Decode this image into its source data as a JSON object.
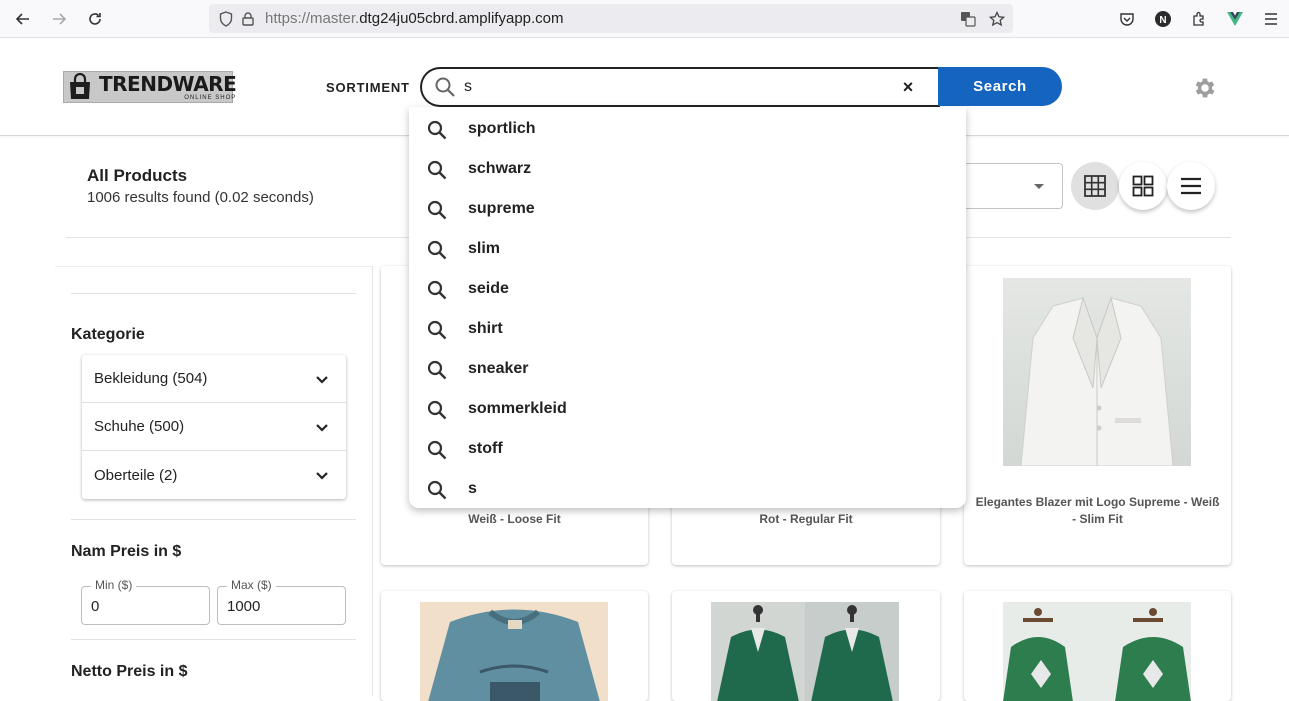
{
  "browser": {
    "url_dim": "https://master.",
    "url_main": "dtg24ju05cbrd.amplifyapp.com"
  },
  "header": {
    "logo_title": "TRENDWARE",
    "logo_subtitle": "ONLINE SHOP",
    "nav_label": "SORTIMENT",
    "search_value": "s",
    "clear_label": "×",
    "search_button": "Search"
  },
  "results": {
    "title": "All Products",
    "count": "1006 results found (0.02 seconds)"
  },
  "sidebar": {
    "category_heading": "Kategorie",
    "categories": [
      {
        "label": "Bekleidung (504)"
      },
      {
        "label": "Schuhe (500)"
      },
      {
        "label": "Oberteile (2)"
      }
    ],
    "price_heading": "Nam Preis in $",
    "min_label": "Min ($)",
    "min_value": "0",
    "max_label": "Max ($)",
    "max_value": "1000",
    "net_heading": "Netto Preis in $"
  },
  "products": [
    {
      "title_fragment": "Weiß - Loose Fit"
    },
    {
      "title_fragment": "Rot - Regular Fit"
    },
    {
      "title": "Elegantes Blazer mit Logo Supreme - Weiß - Slim Fit"
    }
  ],
  "suggestions": [
    {
      "text": "sportlich"
    },
    {
      "text": "schwarz"
    },
    {
      "text": "supreme"
    },
    {
      "text": "slim"
    },
    {
      "text": "seide"
    },
    {
      "text": "shirt"
    },
    {
      "text": "sneaker"
    },
    {
      "text": "sommerkleid"
    },
    {
      "text": "stoff"
    },
    {
      "text": "s"
    }
  ],
  "colors": {
    "accent": "#1565c0",
    "gear": "#9e9e9e"
  }
}
